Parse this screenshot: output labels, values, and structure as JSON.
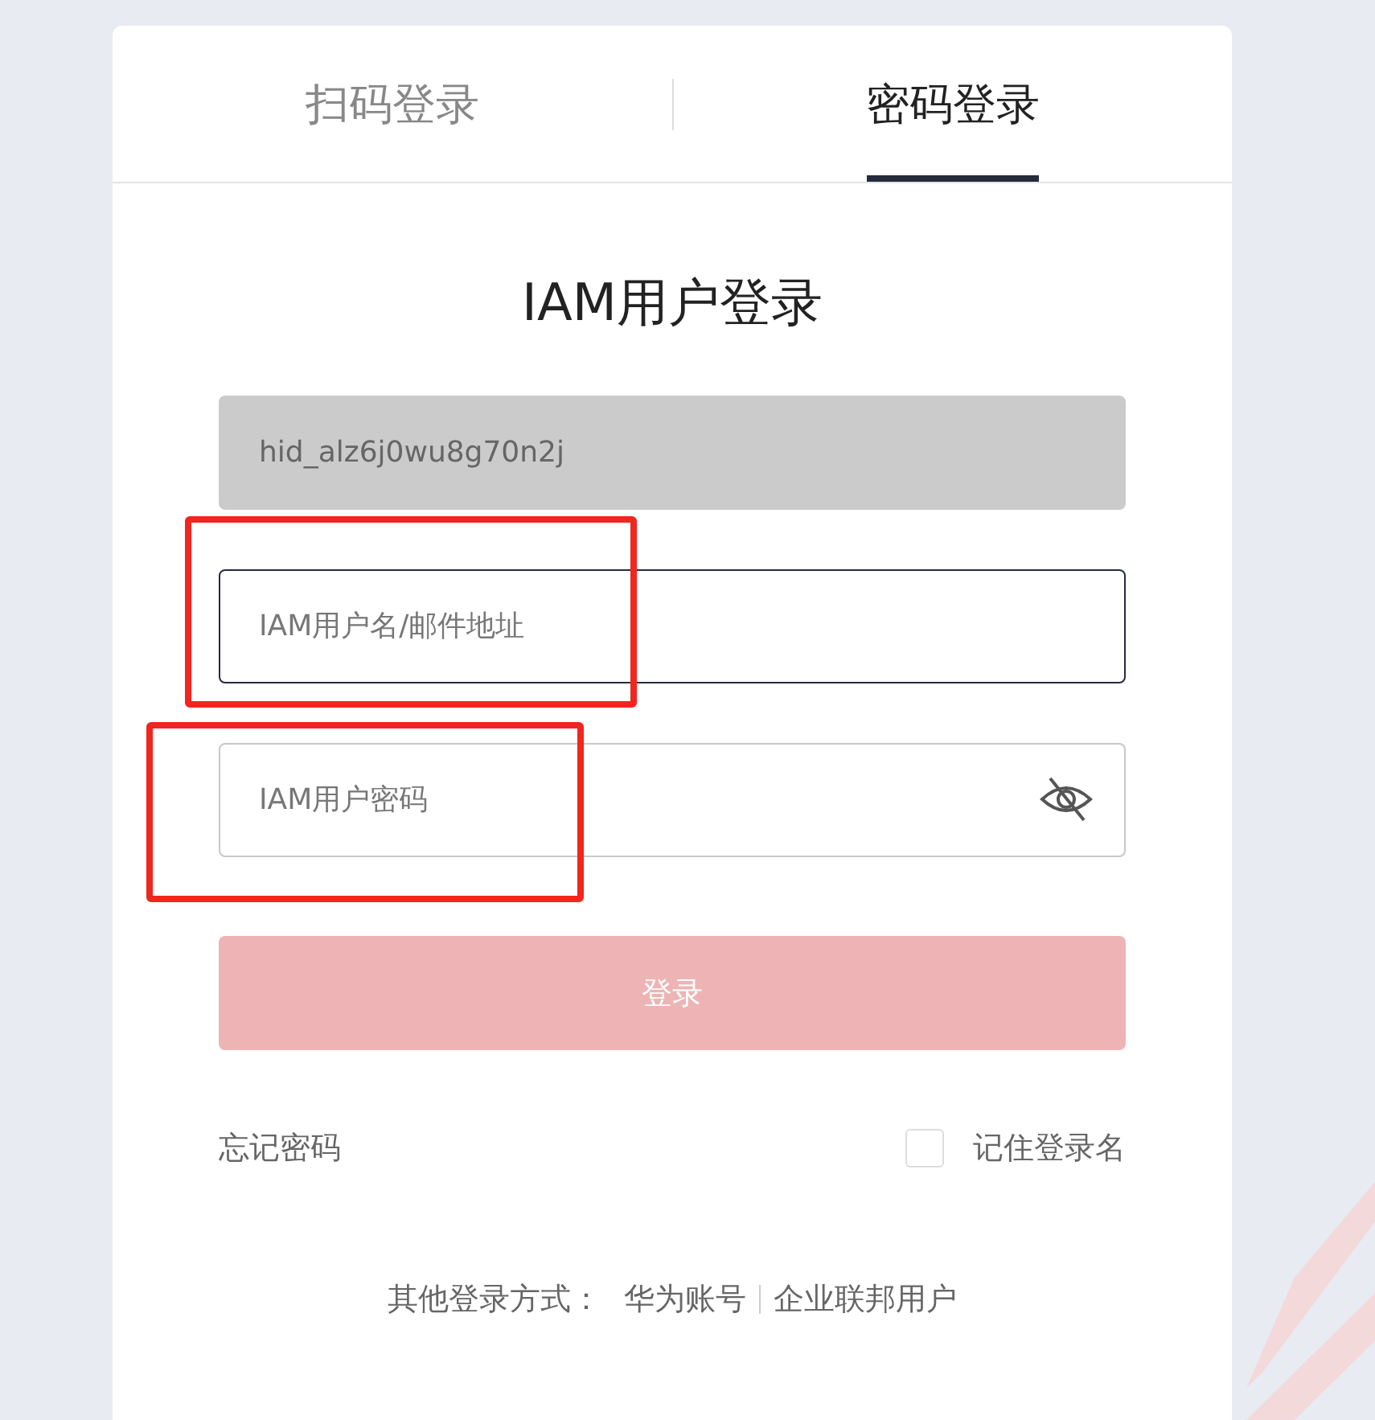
{
  "tabs": [
    {
      "label": "扫码登录",
      "selected": false
    },
    {
      "label": "密码登录",
      "selected": true
    }
  ],
  "title": "IAM用户登录",
  "fields": [
    {
      "kind": "text",
      "value": "hid_alz6j0wu8g70n2j",
      "disabled": true,
      "focused": false,
      "highlighted": false
    },
    {
      "kind": "text",
      "placeholder": "IAM用户名/邮件地址",
      "disabled": false,
      "focused": true,
      "highlighted": true
    },
    {
      "kind": "password",
      "placeholder": "IAM用户密码",
      "disabled": false,
      "focused": false,
      "highlighted": true
    }
  ],
  "login_button": {
    "label": "登录",
    "disabled": true
  },
  "forgot_password": "忘记密码",
  "remember": {
    "label": "记住登录名",
    "checked": false
  },
  "other_login": {
    "label": "其他登录方式：",
    "links": [
      "华为账号",
      "企业联邦用户"
    ]
  }
}
